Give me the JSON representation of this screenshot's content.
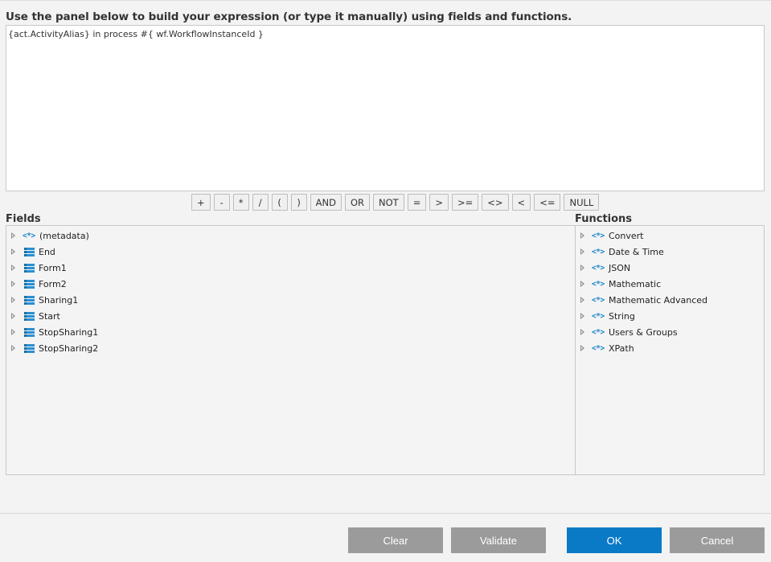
{
  "instruction": "Use the panel below to build your expression (or type it manually) using fields and functions.",
  "expression": "{act.ActivityAlias} in process #{ wf.WorkflowInstanceId }",
  "operators": [
    "+",
    "-",
    "*",
    "/",
    "(",
    ")",
    "AND",
    "OR",
    "NOT",
    "=",
    ">",
    ">=",
    "<>",
    "<",
    "<=",
    "NULL"
  ],
  "fields": {
    "label": "Fields",
    "items": [
      {
        "label": "(metadata)",
        "icon": "function-icon"
      },
      {
        "label": "End",
        "icon": "form-icon"
      },
      {
        "label": "Form1",
        "icon": "form-icon"
      },
      {
        "label": "Form2",
        "icon": "form-icon"
      },
      {
        "label": "Sharing1",
        "icon": "form-icon"
      },
      {
        "label": "Start",
        "icon": "form-icon"
      },
      {
        "label": "StopSharing1",
        "icon": "form-icon"
      },
      {
        "label": "StopSharing2",
        "icon": "form-icon"
      }
    ]
  },
  "functions": {
    "label": "Functions",
    "items": [
      {
        "label": "Convert",
        "icon": "function-icon"
      },
      {
        "label": "Date & Time",
        "icon": "function-icon"
      },
      {
        "label": "JSON",
        "icon": "function-icon"
      },
      {
        "label": "Mathematic",
        "icon": "function-icon"
      },
      {
        "label": "Mathematic Advanced",
        "icon": "function-icon"
      },
      {
        "label": "String",
        "icon": "function-icon"
      },
      {
        "label": "Users & Groups",
        "icon": "function-icon"
      },
      {
        "label": "XPath",
        "icon": "function-icon"
      }
    ]
  },
  "buttons": {
    "clear": "Clear",
    "validate": "Validate",
    "ok": "OK",
    "cancel": "Cancel"
  },
  "colors": {
    "primary": "#0a7ac7",
    "secondary": "#9b9b9b",
    "icon": "#1b86c9"
  }
}
